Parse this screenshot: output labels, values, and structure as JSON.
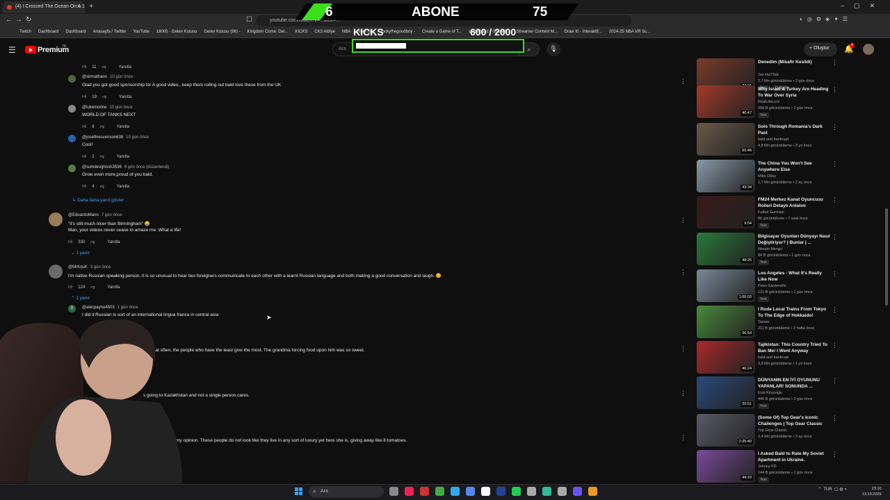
{
  "browser": {
    "tab_title": "(4) I Crossed The Ocean On A 1",
    "url": "youtube.com/watch?v=...&list=...",
    "bookmarks": [
      "Twitch",
      "Dashboard",
      "Dashboard",
      "Anasayfa / Twitter",
      "YouTube",
      "18005 - Gelen Kutusu",
      "Gelen Kutusu (96) -",
      "Kingdom Come: Del...",
      "KICKS",
      "CK3 Atölye",
      "NBA",
      "New Tab",
      "rockythegoodboy -",
      "Create a Game of T...",
      "Letterboxd • Social f...",
      "Streamer Content M...",
      "Draw It! - İnteraktif...",
      "2024-25 NBA VR Sc..."
    ]
  },
  "overlay": {
    "count_left": "6",
    "label": "ABONE",
    "count_right": "75",
    "kicks_label": "KICKS",
    "kicks_progress": "600 / 2000",
    "kicks_fraction": 0.3
  },
  "header": {
    "logo": "Premium",
    "logo_sup": "TR",
    "search_placeholder": "Ara",
    "create_label": "Oluştur",
    "notif_count": "4"
  },
  "comments": [
    {
      "likes": "11",
      "reply": "Yanıtla"
    },
    {
      "author": "@sirrnathann",
      "time": "10 gün önce",
      "text": "Glad you got good sponsorship for A good video,. keep them rolling out bald love these from the UK",
      "likes": "19",
      "reply": "Yanıtla"
    },
    {
      "author": "@lukemorine",
      "time": "10 gün önce",
      "text": "WORLD OF TANKS NEXT",
      "likes": "9",
      "reply": "Yanıtla"
    },
    {
      "author": "@josefinesvenson638",
      "time": "10 gün önce",
      "text": "Cool!",
      "likes": "2",
      "reply": "Yanıtla"
    },
    {
      "author": "@somdevghosh3536",
      "time": "9 gün önce (düzenlendi)",
      "text": "Grow even more,proud of you bald.",
      "likes": "4",
      "reply": "Yanıtla"
    },
    {
      "more": "Daha fazla yanıt göster"
    },
    {
      "author": "@EduardoMano",
      "time": "7 gün önce",
      "text": "\"it's still much nicer than Birmingham\" 😂",
      "text2": "Man, your videos never cease to amaze me. What a life!",
      "likes": "330",
      "reply": "Yanıtla",
      "replies": "1 yanıt"
    },
    {
      "author": "@MrKrjuK",
      "time": "3 gün önce",
      "text": "I'm native Russian speaking person, it is so unusual to hear two foreigners communicate to each other with a learnt Russian language and both making a good conversation and laugh. 😊",
      "likes": "124",
      "reply": "Yanıtla",
      "replies": "1 yanıt"
    },
    {
      "author": "@alecpayne4503",
      "time": "1 gün önce",
      "text": "I did it                  Russian is sort of an international lingua franca in central asia"
    },
    {
      "text": "that often, the people who have the least give the most. The grandma forcing food upon him was so sweet."
    },
    {
      "text": "s going to Kazakhstan and not a single person cares."
    },
    {
      "text": "ive in my opinion. These people do not look like they live in any sort of luxury yet here she is, giving away like 8 tomatoes."
    }
  ],
  "sidebar": [
    {
      "title": "Denedim (Misafir Kesildi)",
      "channel": "Joe HaTTab",
      "meta": "2,7 Mn görüntüleme • 2 gün önce",
      "tags": [
        "Yeni",
        "Dublajlı"
      ],
      "duration": "27:21",
      "thumb": "#7a3a2a"
    },
    {
      "title": "Why Israel & Turkey Are Heading To War Over Syria",
      "channel": "RealLifeLore",
      "meta": "398 B görüntüleme • 2 gün önce",
      "tags": [
        "Yeni"
      ],
      "duration": "40:47",
      "thumb": "#a33a2a"
    },
    {
      "title": "Solo Through Romania's Dark Past",
      "channel": "bald and bankrupt",
      "meta": "4,8 Mn görüntüleme • 3 yıl önce",
      "tags": [],
      "duration": "50:46",
      "thumb": "#6a5a4a"
    },
    {
      "title": "The China You Won't See Anywhere Else",
      "channel": "Mike Okay",
      "meta": "1,7 Mn görüntüleme • 2 ay önce",
      "tags": [],
      "duration": "43:34",
      "thumb": "#8a9aa8"
    },
    {
      "title": "FM24 Merkez Kanat Oyuncusu Rolleri Detaylı Anlatım",
      "channel": "Futbol Gurmesi",
      "meta": "86 görüntüleme • 7 saat önce",
      "tags": [
        "Yeni"
      ],
      "duration": "9:54",
      "thumb": "#3a1a1a"
    },
    {
      "title": "Bilgisayar Oyunları Dünyayı Nasıl Değiştiriyor? | Bunlar | ...",
      "channel": "Nevşin Mengü",
      "meta": "84 B görüntüleme • 1 gün önce",
      "tags": [
        "Yeni"
      ],
      "duration": "48:25",
      "thumb": "#2a7a3a"
    },
    {
      "title": "Los Angeles - What It's Really Like Now",
      "channel": "Peter Santenello",
      "meta": "131 B görüntüleme • 1 gün önce",
      "tags": [
        "Yeni"
      ],
      "duration": "1:00:03",
      "thumb": "#7a8a9a"
    },
    {
      "title": "I Rode Local Trains From Tokyo To The Edge of Hokkaido!",
      "channel": "Tanner",
      "meta": "211 B görüntüleme • 2 hafta önce",
      "tags": [],
      "duration": "36:54",
      "thumb": "#4a8a3a"
    },
    {
      "title": "Tajikistan: This Country Tried To Ban Me! I Went Anyway",
      "channel": "bald and bankrupt",
      "meta": "3,6 Mn görüntüleme • 1 yıl önce",
      "tags": [],
      "duration": "46:24",
      "thumb": "#a82a2a"
    },
    {
      "title": "DÜNYANIN EN İYİ OYUNUNU YAPANLAR! SONUNDA ...",
      "channel": "Enis Kirazoglu",
      "meta": "440 B görüntüleme • 2 gün önce",
      "tags": [
        "Yeni"
      ],
      "duration": "20:51",
      "thumb": "#2a4a7a"
    },
    {
      "title": "(Some Of) Top Gear's Iconic Challenges | Top Gear Classic",
      "channel": "Top Gear Classic",
      "meta": "2,4 Mn görüntüleme • 3 ay önce",
      "tags": [],
      "duration": "2:35:40",
      "thumb": "#5a5a6a"
    },
    {
      "title": "I Asked Bald to Rate My Soviet Apartment in Ukraine.",
      "channel": "Johnny FD",
      "meta": "144 B görüntüleme • 1 gün önce",
      "tags": [
        "Yeni"
      ],
      "duration": "44:10",
      "thumb": "#7a4a9a"
    }
  ],
  "taskbar": {
    "search": "Ara",
    "lang": "TUR",
    "time": "23:10",
    "date": "13.10.2025"
  }
}
